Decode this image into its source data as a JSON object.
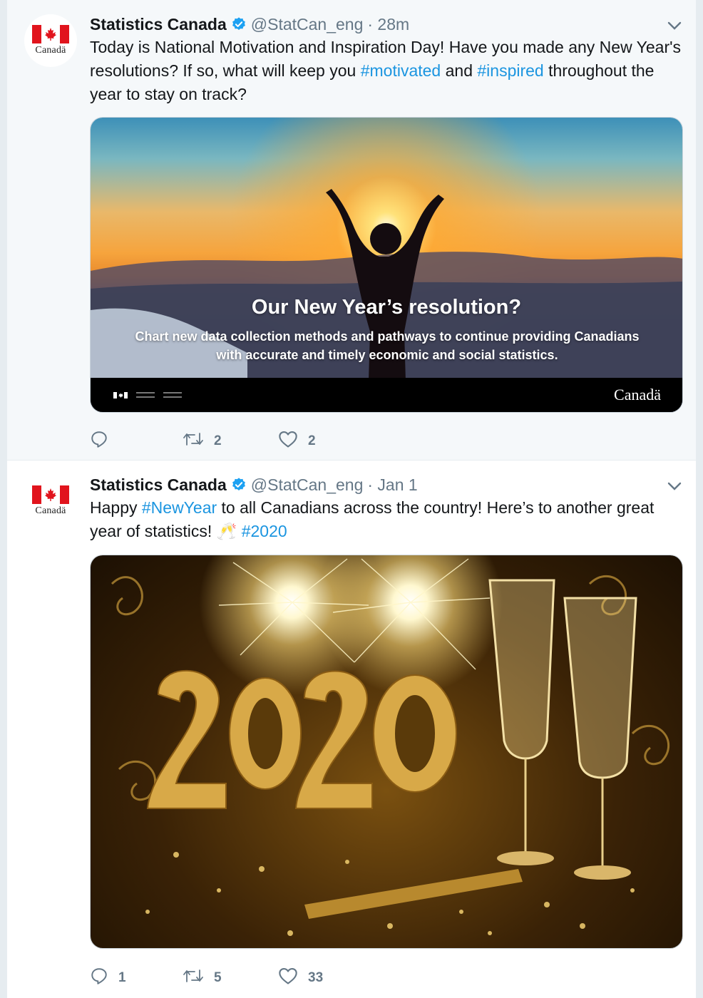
{
  "colors": {
    "accent": "#1b95e0",
    "muted": "#657786",
    "flag_red": "#e1141d",
    "verified": "#1da1f2"
  },
  "tweets": [
    {
      "author_name": "Statistics Canada",
      "handle": "@StatCan_eng",
      "time": "· 28m",
      "text_parts": [
        "Today is National Motivation and Inspiration Day! Have you made any New Year's resolutions? If so, what will keep you ",
        "#motivated",
        " and ",
        "#inspired",
        " throughout the year to stay on track?"
      ],
      "avatar_wordmark": "Canadä",
      "media": {
        "title": "Our New Year’s resolution?",
        "subtitle": "Chart new data collection methods and pathways to continue providing Canadians with accurate and timely economic and social statistics.",
        "footer_wordmark": "Canadä"
      },
      "replies": "",
      "retweets": "2",
      "likes": "2"
    },
    {
      "author_name": "Statistics Canada",
      "handle": "@StatCan_eng",
      "time": "· Jan 1",
      "text_parts": [
        "Happy ",
        "#NewYear",
        " to all Canadians across the country!  Here’s to another great year of statistics! ",
        "🥂",
        " ",
        "#2020"
      ],
      "avatar_wordmark": "Canadä",
      "replies": "1",
      "retweets": "5",
      "likes": "33"
    }
  ],
  "icons": {
    "verified": "verified-badge-icon",
    "caret": "chevron-down-icon",
    "reply": "reply-icon",
    "retweet": "retweet-icon",
    "like": "heart-icon",
    "emoji": "champagne-glasses-emoji"
  }
}
